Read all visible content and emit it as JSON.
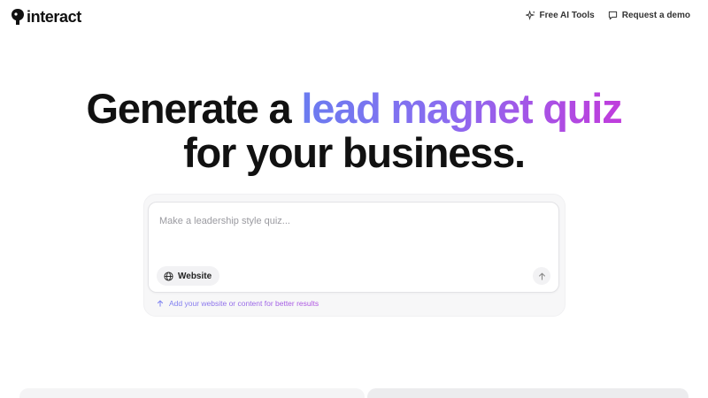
{
  "header": {
    "logo_text": "interact",
    "nav": [
      {
        "label": "Free AI Tools",
        "icon": "sparkle-icon"
      },
      {
        "label": "Request a demo",
        "icon": "chat-bubble-icon"
      }
    ]
  },
  "hero": {
    "title_part1": "Generate a",
    "title_accent": "lead magnet quiz",
    "title_part2": "for your business."
  },
  "prompt": {
    "placeholder": "Make a leadership style quiz...",
    "value": "",
    "website_label": "Website",
    "hint": "Add your website or content for better results"
  },
  "colors": {
    "accent_start": "#6b7cf0",
    "accent_end": "#c03cdc",
    "text": "#111111",
    "card_bg": "#f7f7f8"
  }
}
